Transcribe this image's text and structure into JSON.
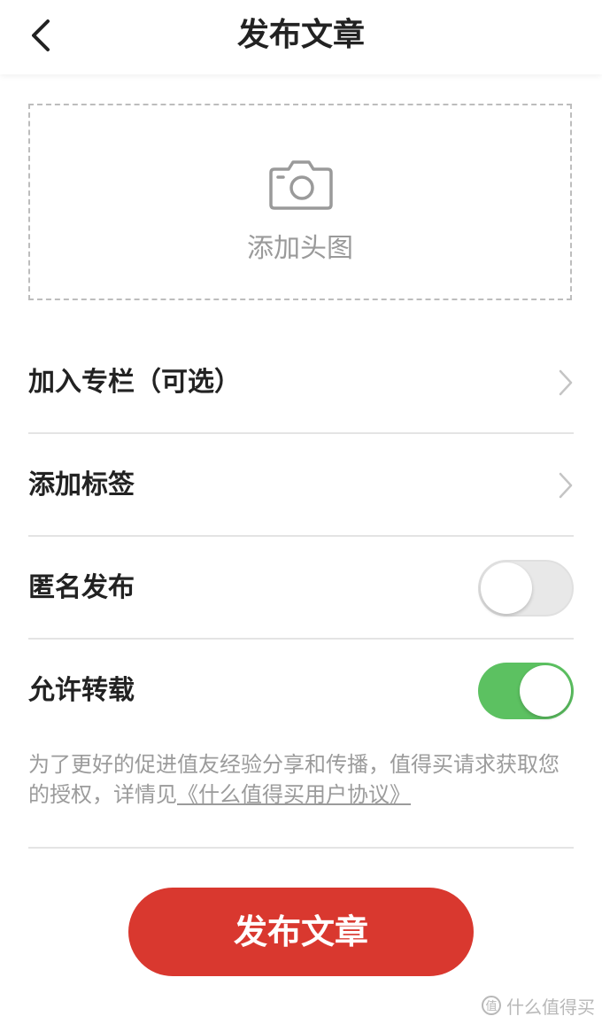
{
  "header": {
    "title": "发布文章",
    "back_icon": "chevron-left-icon"
  },
  "cover": {
    "label": "添加头图",
    "icon": "camera-icon"
  },
  "rows": {
    "column": {
      "label": "加入专栏（可选）"
    },
    "tags": {
      "label": "添加标签"
    },
    "anonymous": {
      "label": "匿名发布",
      "enabled": false
    },
    "repost": {
      "label": "允许转载",
      "enabled": true
    }
  },
  "notice": {
    "text": "为了更好的促进值友经验分享和传播，值得买请求获取您的授权，详情见",
    "link_text": "《什么值得买用户协议》"
  },
  "publish_button": {
    "label": "发布文章"
  },
  "watermark": {
    "text": "什么值得买"
  },
  "colors": {
    "primary_red": "#d9382f",
    "toggle_on": "#5cc161",
    "toggle_off": "#e8e8e8",
    "muted_text": "#9b9b9b"
  }
}
